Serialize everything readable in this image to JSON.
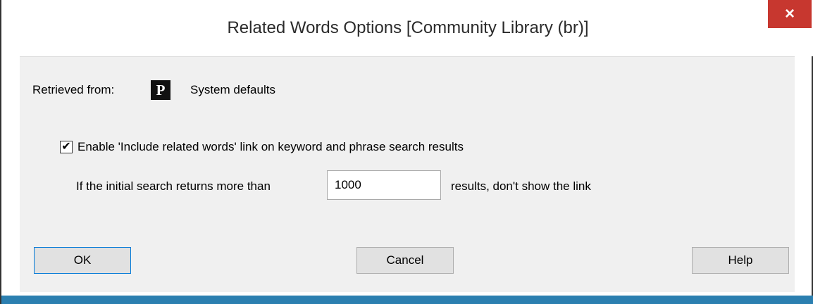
{
  "window": {
    "title": "Related Words Options [Community Library  (br)]",
    "close_glyph": "×"
  },
  "retrieved": {
    "label": "Retrieved from:",
    "icon": "P",
    "source": "System defaults"
  },
  "enable": {
    "checked": true,
    "check_glyph": "✔",
    "label": "Enable 'Include related words' link on keyword and phrase search results"
  },
  "threshold": {
    "prefix": "If the initial search returns more than",
    "value": "1000",
    "suffix": "results, don't show the link"
  },
  "buttons": {
    "ok": "OK",
    "cancel": "Cancel",
    "help": "Help"
  },
  "colors": {
    "close_bg": "#c7372f",
    "accent": "#2b7fb0",
    "dialog_bg": "#f0f0f0"
  }
}
